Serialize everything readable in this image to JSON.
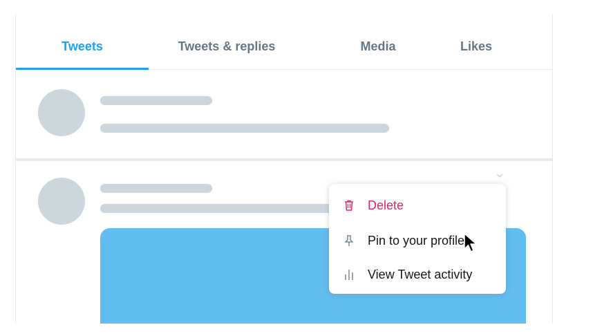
{
  "tabs": [
    {
      "label": "Tweets",
      "active": true
    },
    {
      "label": "Tweets & replies",
      "active": false
    },
    {
      "label": "Media",
      "active": false
    },
    {
      "label": "Likes",
      "active": false
    }
  ],
  "menu": {
    "items": [
      {
        "label": "Delete",
        "icon": "trash-icon"
      },
      {
        "label": "Pin to your profile",
        "icon": "pin-icon"
      },
      {
        "label": "View Tweet activity",
        "icon": "activity-icon"
      }
    ]
  },
  "colors": {
    "accent": "#1da1f2",
    "danger": "#e0245e",
    "placeholder": "#ccd6dd",
    "media": "#62bdf0"
  }
}
